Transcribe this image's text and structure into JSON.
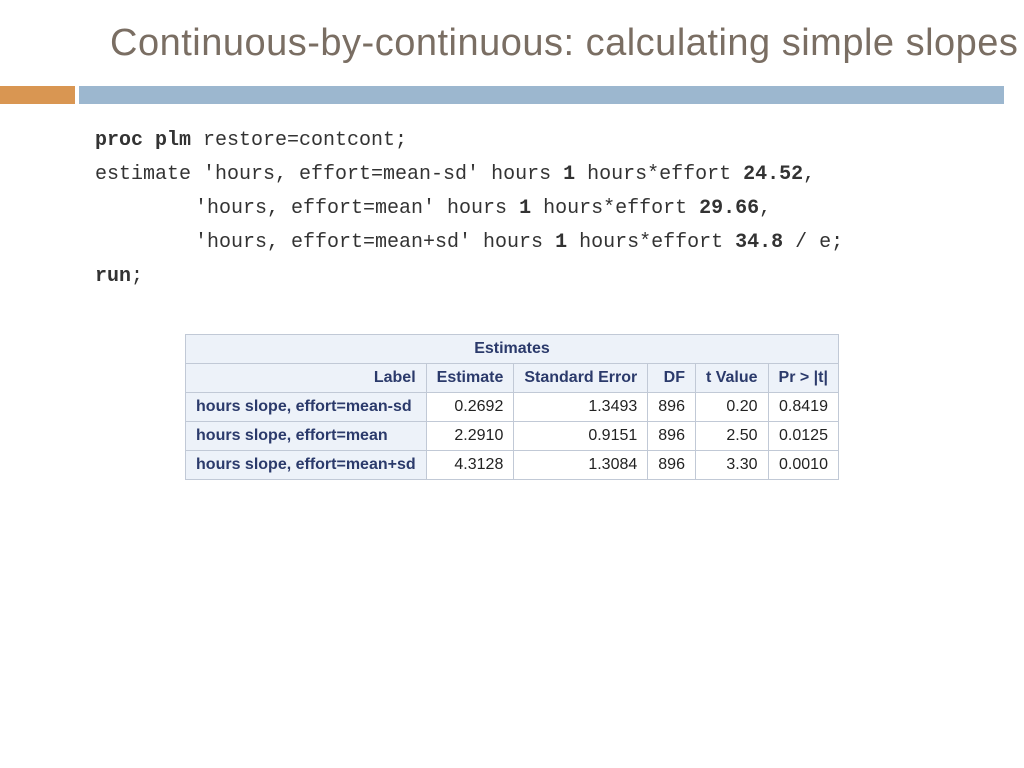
{
  "title": "Continuous-by-continuous: calculating simple slopes",
  "code": {
    "l1a": "proc plm",
    "l1b": " restore=contcont;",
    "l2a": "estimate 'hours, effort=mean-sd' hours ",
    "l2b": "1",
    "l2c": " hours*effort ",
    "l2d": "24.52",
    "l2e": ",",
    "l3a": "'hours, effort=mean' hours ",
    "l3b": "1",
    "l3c": " hours*effort ",
    "l3d": "29.66",
    "l3e": ",",
    "l4a": "'hours, effort=mean+sd' hours ",
    "l4b": "1",
    "l4c": " hours*effort ",
    "l4d": "34.8",
    "l4e": " / e;",
    "l5a": "run",
    "l5b": ";"
  },
  "table": {
    "title": "Estimates",
    "headers": [
      "Label",
      "Estimate",
      "Standard Error",
      "DF",
      "t Value",
      "Pr > |t|"
    ],
    "rows": [
      {
        "label": "hours slope, effort=mean-sd",
        "estimate": "0.2692",
        "stderr": "1.3493",
        "df": "896",
        "tval": "0.20",
        "p": "0.8419"
      },
      {
        "label": "hours slope, effort=mean",
        "estimate": "2.2910",
        "stderr": "0.9151",
        "df": "896",
        "tval": "2.50",
        "p": "0.0125"
      },
      {
        "label": "hours slope, effort=mean+sd",
        "estimate": "4.3128",
        "stderr": "1.3084",
        "df": "896",
        "tval": "3.30",
        "p": "0.0010"
      }
    ]
  }
}
